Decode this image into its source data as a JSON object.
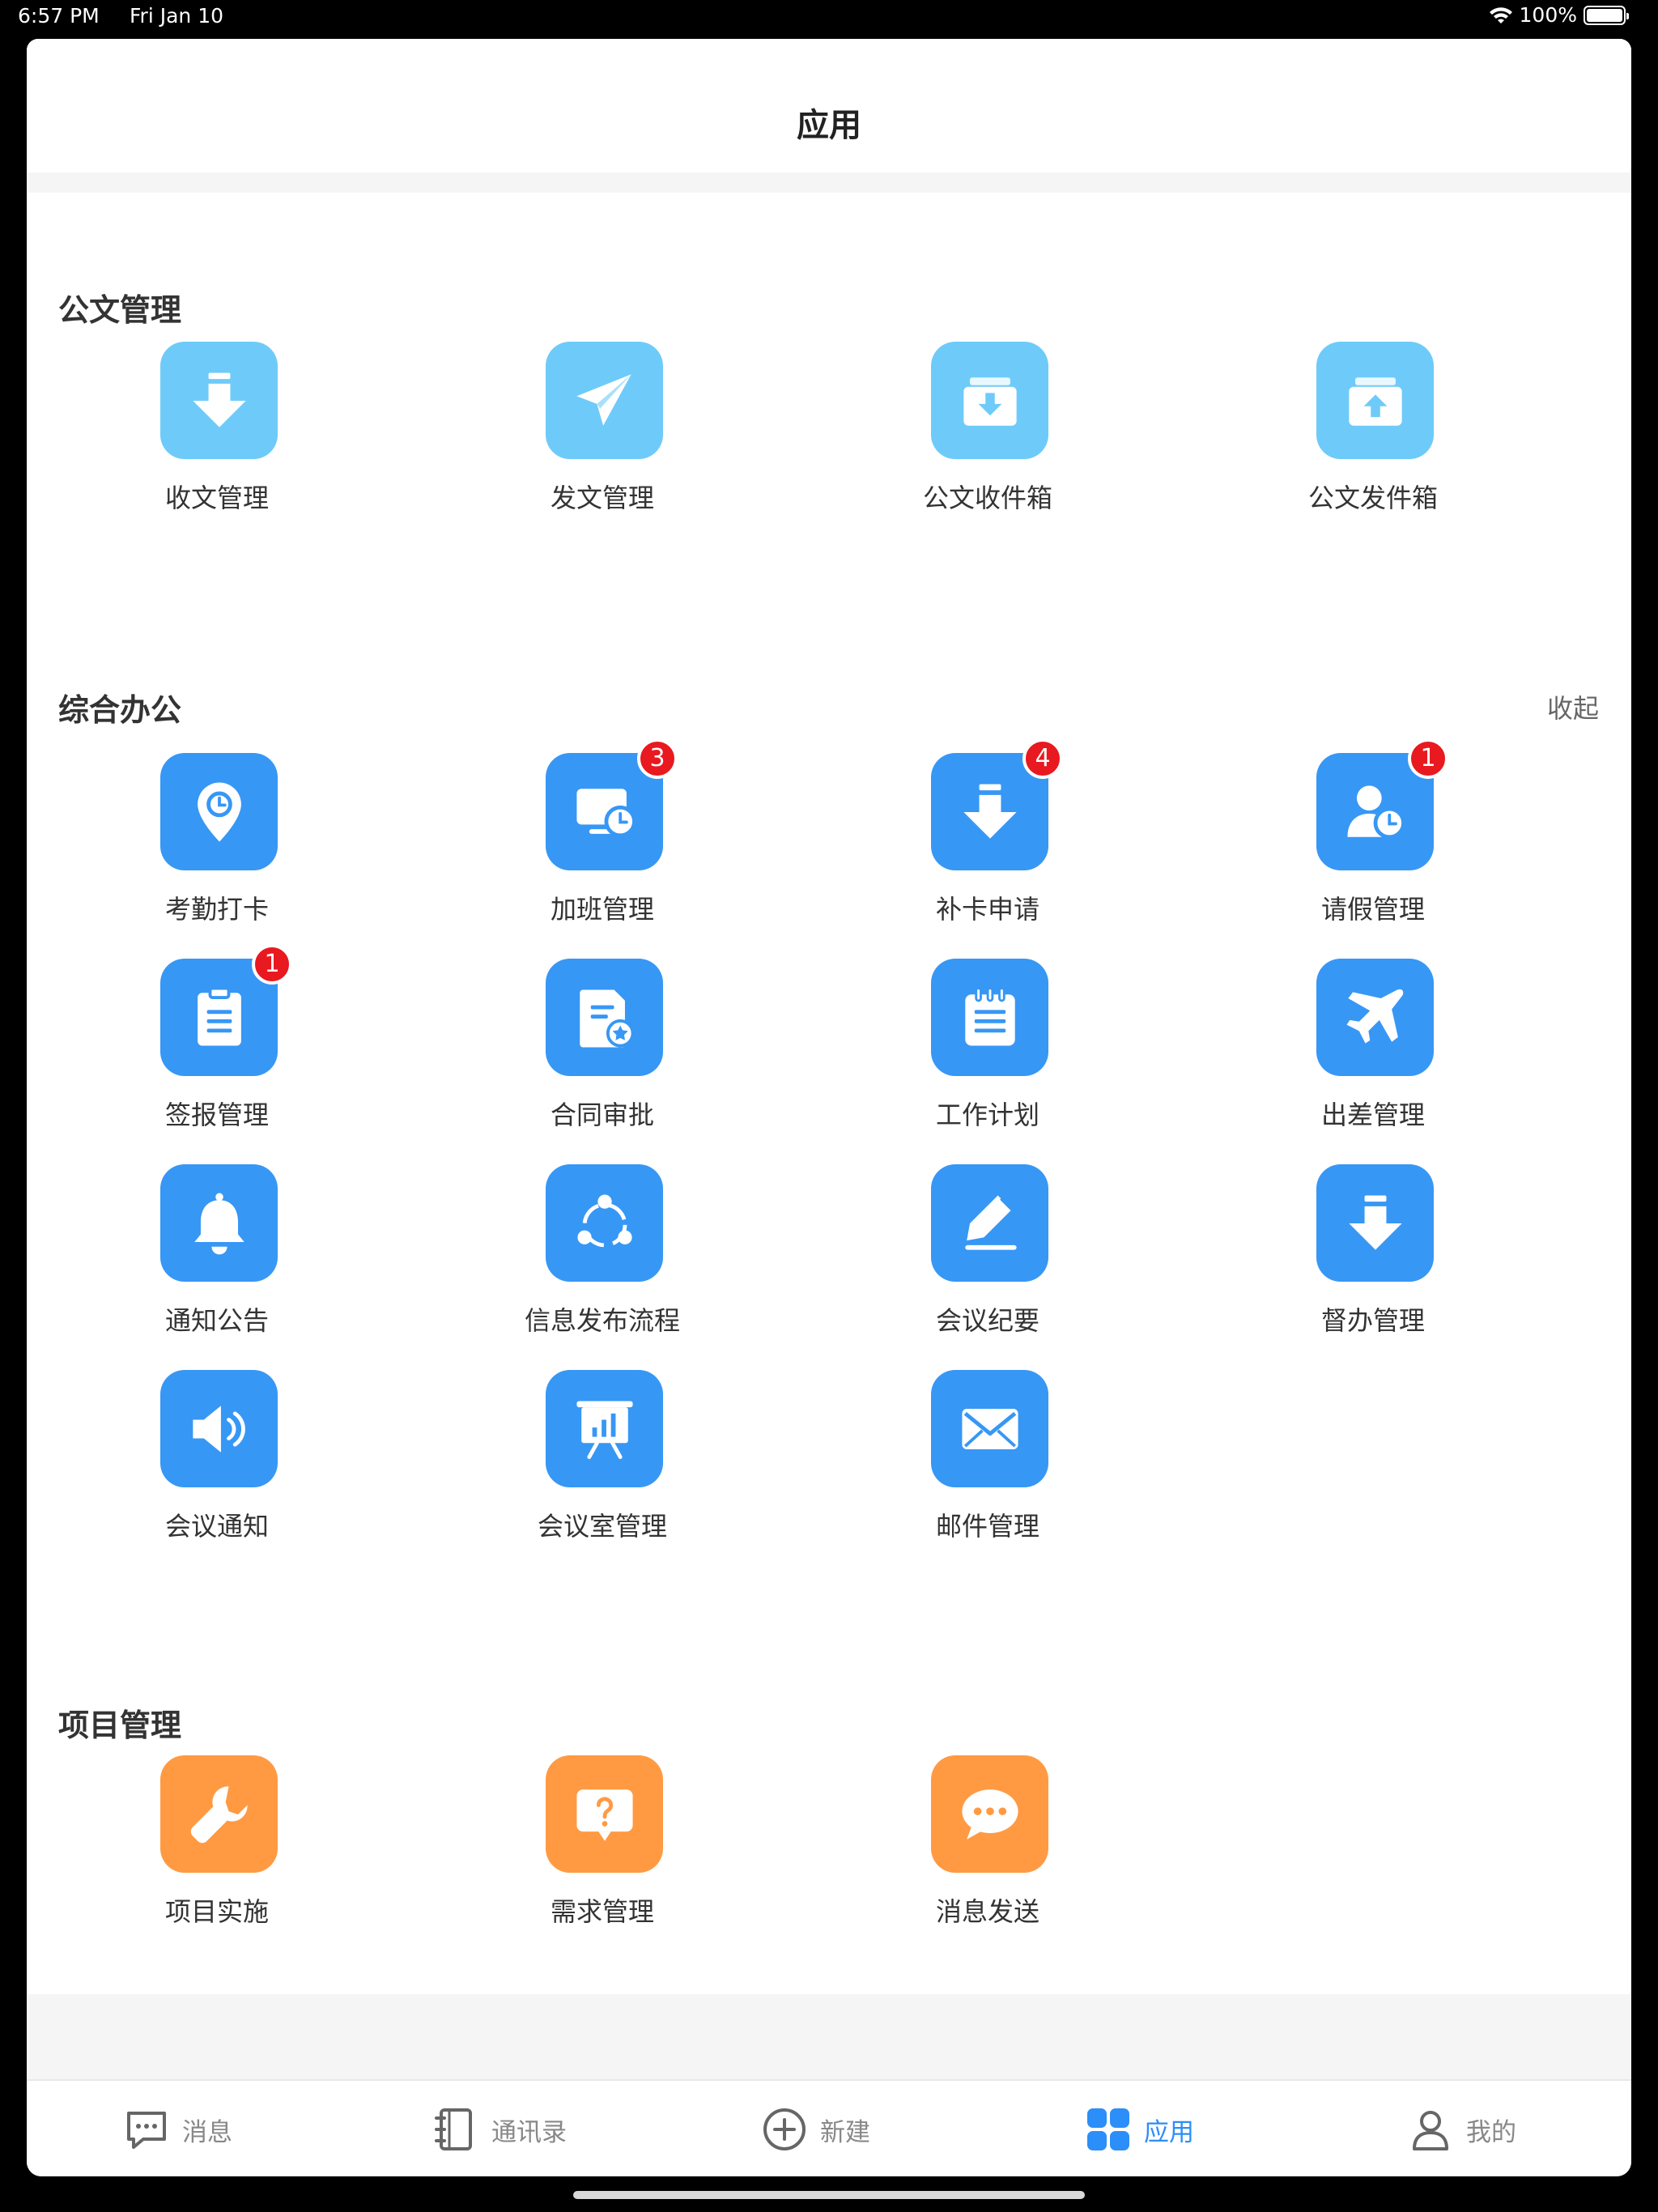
{
  "status_bar": {
    "time": "6:57 PM",
    "date": "Fri Jan 10",
    "battery": "100%"
  },
  "nav": {
    "title": "应用"
  },
  "sections": {
    "official": {
      "title": "公文管理"
    },
    "office": {
      "title": "综合办公",
      "collapse": "收起"
    },
    "project": {
      "title": "项目管理"
    }
  },
  "apps": {
    "receive_doc": {
      "label": "收文管理"
    },
    "send_doc": {
      "label": "发文管理"
    },
    "doc_inbox": {
      "label": "公文收件箱"
    },
    "doc_outbox": {
      "label": "公文发件箱"
    },
    "attendance": {
      "label": "考勤打卡"
    },
    "overtime": {
      "label": "加班管理",
      "badge": "3"
    },
    "card_fix": {
      "label": "补卡申请",
      "badge": "4"
    },
    "leave": {
      "label": "请假管理",
      "badge": "1"
    },
    "report": {
      "label": "签报管理",
      "badge": "1"
    },
    "contract": {
      "label": "合同审批"
    },
    "work_plan": {
      "label": "工作计划"
    },
    "business_trip": {
      "label": "出差管理"
    },
    "notice": {
      "label": "通知公告"
    },
    "info_publish": {
      "label": "信息发布流程"
    },
    "minutes": {
      "label": "会议纪要"
    },
    "supervise": {
      "label": "督办管理"
    },
    "meeting_notice": {
      "label": "会议通知"
    },
    "meeting_room": {
      "label": "会议室管理"
    },
    "mail": {
      "label": "邮件管理"
    },
    "project_impl": {
      "label": "项目实施"
    },
    "requirement": {
      "label": "需求管理"
    },
    "message_send": {
      "label": "消息发送"
    }
  },
  "tabs": {
    "messages": "消息",
    "contacts": "通讯录",
    "create": "新建",
    "apps": "应用",
    "mine": "我的"
  },
  "colors": {
    "light_blue": "#6ecbf9",
    "blue": "#3797f5",
    "orange": "#ff9a43",
    "active_tab": "#2c8ef8",
    "badge": "#e8191f"
  }
}
